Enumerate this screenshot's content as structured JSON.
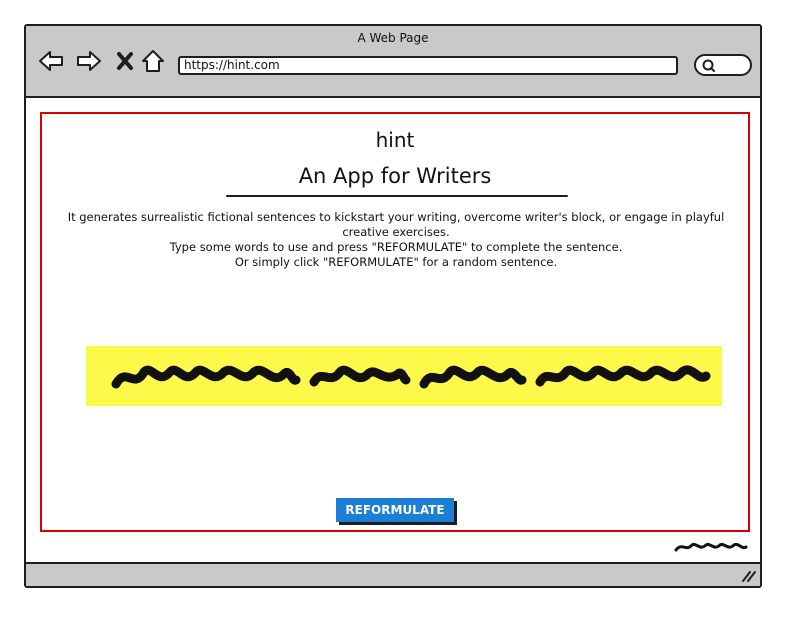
{
  "window": {
    "title": "A Web Page"
  },
  "browser": {
    "url": "https://hint.com",
    "icons": [
      "back-arrow-icon",
      "forward-arrow-icon",
      "close-icon",
      "home-icon",
      "search-icon"
    ]
  },
  "app": {
    "name": "hint",
    "tagline": "An App for Writers",
    "description_lines": [
      "It generates surrealistic fictional sentences to kickstart your writing, overcome writer's block, or engage in playful creative exercises.",
      "Type some words to use and press \"REFORMULATE\" to complete the sentence.",
      "Or simply click \"REFORMULATE\" for a random sentence."
    ],
    "reformulate_label": "REFORMULATE"
  },
  "colors": {
    "frame_border": "#d90000",
    "sentence_highlight": "#fdf94b",
    "button": "#1b7fd6",
    "chrome": "#c9c9c9"
  }
}
